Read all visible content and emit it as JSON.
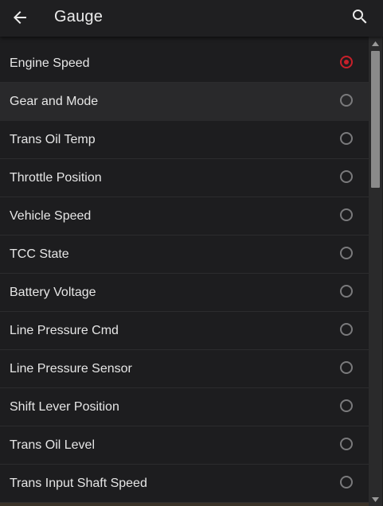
{
  "header": {
    "title": "Gauge",
    "back_icon": "arrow-left-icon",
    "search_icon": "search-icon"
  },
  "colors": {
    "accent": "#c8202a",
    "background": "#1d1d1f",
    "text": "#e6e6e6"
  },
  "list": {
    "selected_index": 0,
    "items": [
      {
        "label": "Engine Speed",
        "selected": true
      },
      {
        "label": "Gear and Mode",
        "selected": false
      },
      {
        "label": "Trans Oil Temp",
        "selected": false
      },
      {
        "label": "Throttle Position",
        "selected": false
      },
      {
        "label": "Vehicle Speed",
        "selected": false
      },
      {
        "label": "TCC State",
        "selected": false
      },
      {
        "label": "Battery Voltage",
        "selected": false
      },
      {
        "label": "Line Pressure Cmd",
        "selected": false
      },
      {
        "label": "Line Pressure Sensor",
        "selected": false
      },
      {
        "label": "Shift Lever Position",
        "selected": false
      },
      {
        "label": "Trans Oil Level",
        "selected": false
      },
      {
        "label": "Trans Input Shaft Speed",
        "selected": false
      }
    ]
  }
}
